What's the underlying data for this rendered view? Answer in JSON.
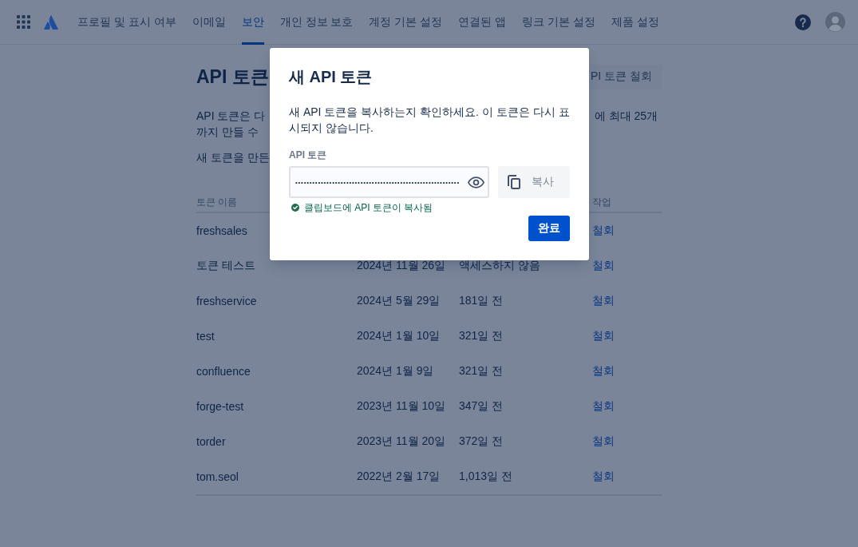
{
  "nav": {
    "tabs": [
      {
        "label": "프로필 및 표시 여부",
        "selected": false
      },
      {
        "label": "이메일",
        "selected": false
      },
      {
        "label": "보안",
        "selected": true
      },
      {
        "label": "개인 정보 보호",
        "selected": false
      },
      {
        "label": "계정 기본 설정",
        "selected": false
      },
      {
        "label": "연결된 앱",
        "selected": false
      },
      {
        "label": "링크 기본 설정",
        "selected": false
      },
      {
        "label": "제품 설정",
        "selected": false
      }
    ]
  },
  "page": {
    "title": "API 토큰",
    "revoke_button": "PI 토큰 철회",
    "description_lines": [
      [
        "API 토큰은 다",
        "에 최대 25개"
      ],
      [
        "까지 만들 수"
      ]
    ],
    "note": "새 토큰을 만든"
  },
  "table": {
    "columns": {
      "name": "토큰 이름",
      "action": "작업"
    },
    "rows": [
      {
        "name": "freshsales",
        "action": "철회"
      },
      {
        "name": "토큰 테스트",
        "column_2": "2024년 11월 26일",
        "column_3": "액세스하지 않음",
        "action": "철회"
      },
      {
        "name": "freshservice",
        "column_2": "2024년 5월 29일",
        "column_3": "181일 전",
        "action": "철회"
      },
      {
        "name": "test",
        "column_2": "2024년 1월 10일",
        "column_3": "321일 전",
        "action": "철회"
      },
      {
        "name": "confluence",
        "column_2": "2024년 1월 9일",
        "column_3": "321일 전",
        "action": "철회"
      },
      {
        "name": "forge-test",
        "column_2": "2023년 11월 10일",
        "column_3": "347일 전",
        "action": "철회"
      },
      {
        "name": "torder",
        "column_2": "2023년 11월 20일",
        "column_3": "372일 전",
        "action": "철회"
      },
      {
        "name": "tom.seol",
        "column_2": "2022년 2월 17일",
        "column_3": "1,013일 전",
        "action": "철회"
      }
    ]
  },
  "dialog": {
    "title": "새 API 토큰",
    "message": "새 API 토큰을 복사하는지 확인하세요. 이 토큰은 다시 표시되지 않습니다.",
    "field": {
      "label": "API 토큰",
      "value": "••••••••••••••••••••••••••••••••••••••••••••••••••••••••••"
    },
    "copy_button": "복사",
    "status": "클립보드에 API 토큰이 복사됨",
    "done_button": "완료"
  }
}
